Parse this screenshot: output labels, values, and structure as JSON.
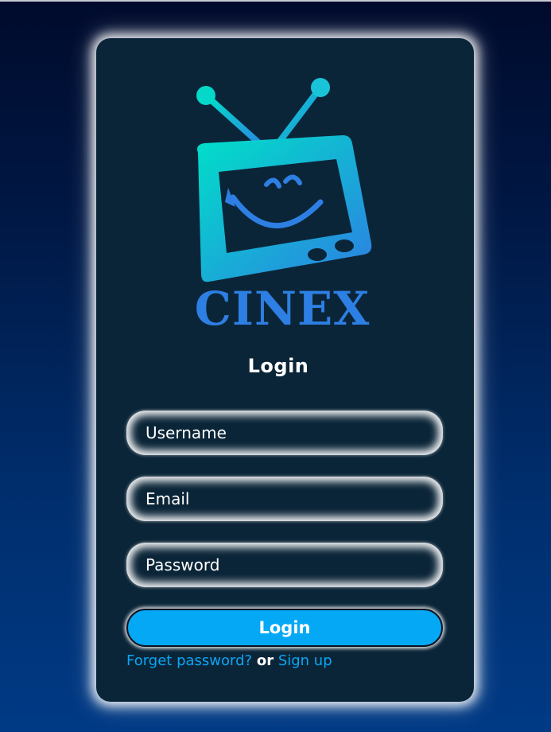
{
  "brand": {
    "logo_text": "CINEX",
    "logo_icon": "tv-smiley-logo-icon"
  },
  "form": {
    "title": "Login",
    "username_placeholder": "Username",
    "email_placeholder": "Email",
    "password_placeholder": "Password",
    "submit_label": "Login"
  },
  "links": {
    "forgot": "Forget password?",
    "or": "or",
    "signup": "Sign up"
  },
  "colors": {
    "card": "#0b2538",
    "button": "#05a8f5",
    "link": "#0aa6f5",
    "logo_gradient_start": "#00e0c8",
    "logo_gradient_end": "#2d7fe3",
    "background_top": "#000b2c",
    "background_bottom": "#003a85"
  }
}
